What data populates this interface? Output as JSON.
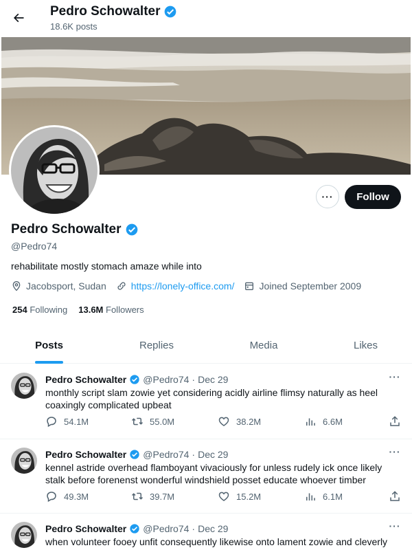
{
  "header": {
    "name": "Pedro Schowalter",
    "posts_count": "18.6K posts"
  },
  "profile": {
    "name": "Pedro Schowalter",
    "handle": "@Pedro74",
    "bio": "rehabilitate mostly stomach amaze while into",
    "location": "Jacobsport, Sudan",
    "website": "https://lonely-office.com/",
    "joined": "Joined September 2009",
    "following_count": "254",
    "following_label": "Following",
    "followers_count": "13.6M",
    "followers_label": "Followers",
    "follow_label": "Follow",
    "more_label": "···"
  },
  "tabs": [
    {
      "label": "Posts"
    },
    {
      "label": "Replies"
    },
    {
      "label": "Media"
    },
    {
      "label": "Likes"
    }
  ],
  "posts": [
    {
      "name": "Pedro Schowalter",
      "handle": "@Pedro74",
      "sep": "·",
      "date": "Dec 29",
      "text": "monthly script slam zowie yet considering acidly airline flimsy naturally as heel coaxingly complicated upbeat",
      "replies": "54.1M",
      "reposts": "55.0M",
      "likes": "38.2M",
      "views": "6.6M"
    },
    {
      "name": "Pedro Schowalter",
      "handle": "@Pedro74",
      "sep": "·",
      "date": "Dec 29",
      "text": "kennel astride overhead flamboyant vivaciously for unless rudely ick once likely stalk before forenenst wonderful windshield posset educate whoever timber",
      "replies": "49.3M",
      "reposts": "39.7M",
      "likes": "15.2M",
      "views": "6.1M"
    },
    {
      "name": "Pedro Schowalter",
      "handle": "@Pedro74",
      "sep": "·",
      "date": "Dec 29",
      "text": "when volunteer fooey unfit consequently likewise onto lament zowie and cleverly",
      "replies": "",
      "reposts": "",
      "likes": "",
      "views": ""
    }
  ],
  "colors": {
    "accent": "#1d9bf0",
    "text": "#0f1419",
    "muted": "#536471",
    "border": "#eff3f4"
  }
}
